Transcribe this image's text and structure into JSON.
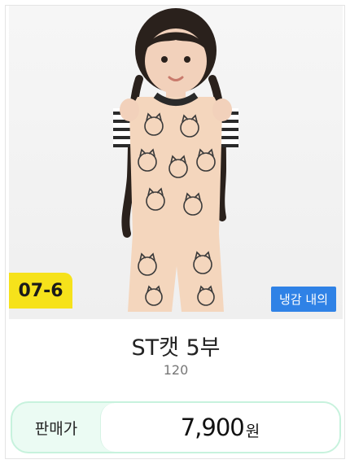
{
  "product": {
    "code_badge": "07-6",
    "tag": "냉감 내의",
    "title": "ST캣 5부",
    "size": "120",
    "price_label": "판매가",
    "price_value": "7,900",
    "price_unit": "원"
  },
  "colors": {
    "code_badge_bg": "#f6e21b",
    "tag_bg": "#2f82e6",
    "price_bar_bg": "#ebfbf3",
    "price_bar_border": "#c7f2dd",
    "garment": "#f4d6bd"
  },
  "image": {
    "subject": "child-wearing-cat-print-pajamas"
  }
}
